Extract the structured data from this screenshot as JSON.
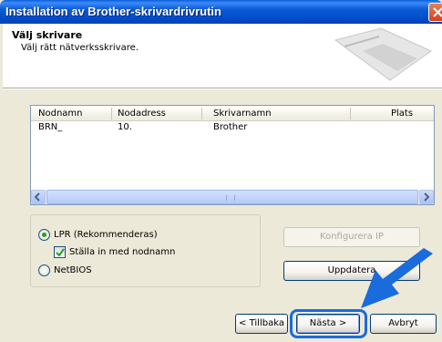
{
  "window": {
    "title": "Installation av Brother-skrivardrivrutin"
  },
  "header": {
    "title": "Välj skrivare",
    "subtitle": "Välj rätt nätverksskrivare."
  },
  "printer_list": {
    "columns": [
      "Nodnamn",
      "Nodadress",
      "Skrivarnamn",
      "Plats"
    ],
    "rows": [
      [
        "BRN_",
        "10.",
        "Brother",
        ""
      ]
    ]
  },
  "options": {
    "lpr_label": "LPR (Rekommenderas)",
    "lpr_selected": true,
    "nodename_label": "Ställa in med nodnamn",
    "nodename_checked": true,
    "netbios_label": "NetBIOS",
    "netbios_selected": false
  },
  "buttons": {
    "configure_ip": "Konfigurera IP",
    "update": "Uppdatera",
    "back": "< Tillbaka",
    "next": "Nästa >",
    "cancel": "Avbryt"
  },
  "colors": {
    "titlebar": "#0b5bd6",
    "highlight": "#1a6bdc",
    "dialog_bg": "#ece9d8"
  }
}
